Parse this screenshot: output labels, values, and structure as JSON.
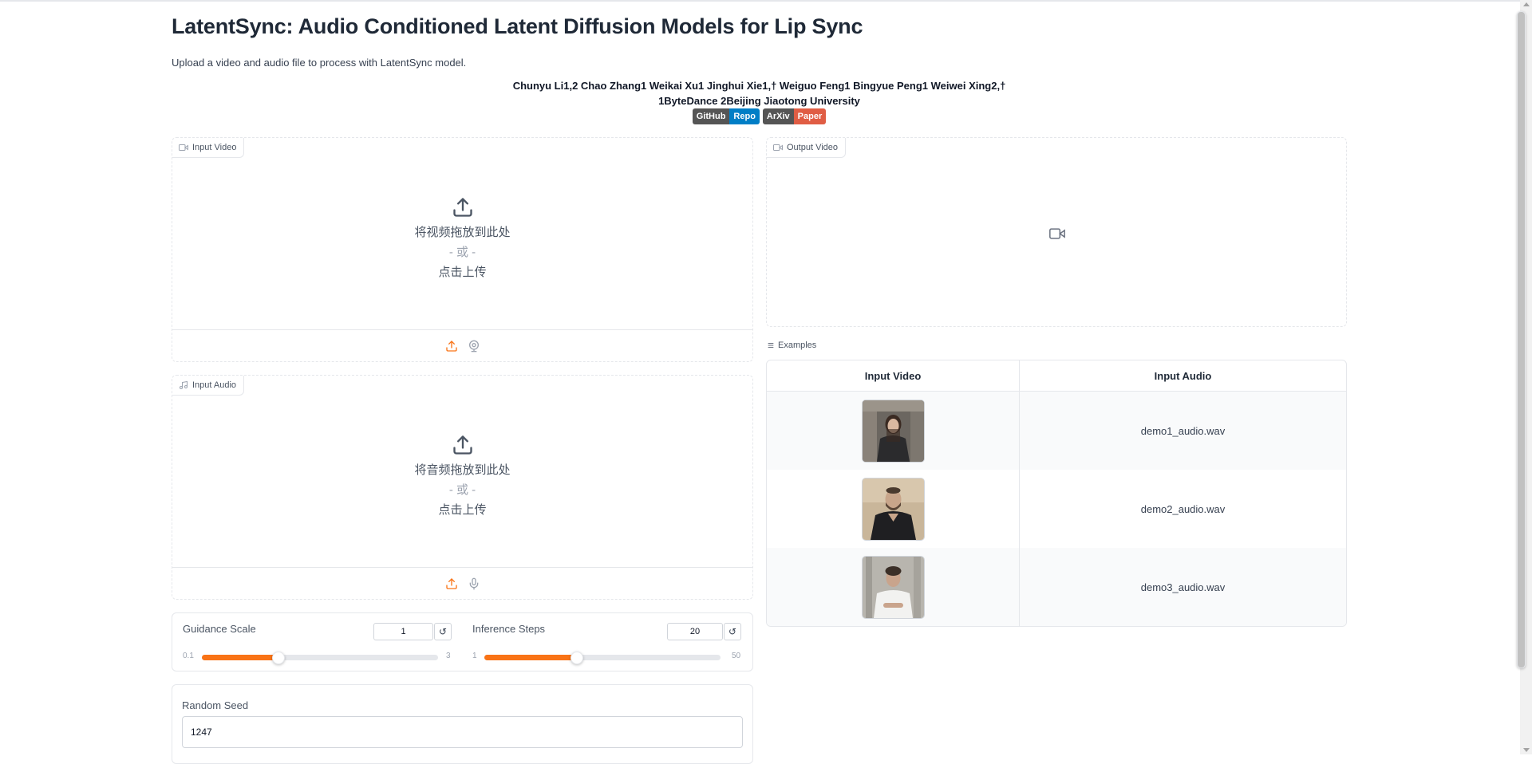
{
  "header": {
    "title": "LatentSync: Audio Conditioned Latent Diffusion Models for Lip Sync",
    "subtitle": "Upload a video and audio file to process with LatentSync model.",
    "authors_line1": "Chunyu Li1,2 Chao Zhang1 Weikai Xu1 Jinghui Xie1,† Weiguo Feng1 Bingyue Peng1 Weiwei Xing2,†",
    "authors_line2": "1ByteDance 2Beijing Jiaotong University",
    "badges": [
      {
        "left": "GitHub",
        "right": "Repo",
        "right_color": "#007ec6"
      },
      {
        "left": "ArXiv",
        "right": "Paper",
        "right_color": "#e05d44"
      }
    ]
  },
  "input_video": {
    "label": "Input Video",
    "drop_text": "将视频拖放到此处",
    "or_text": "- 或 -",
    "click_text": "点击上传"
  },
  "input_audio": {
    "label": "Input Audio",
    "drop_text": "将音频拖放到此处",
    "or_text": "- 或 -",
    "click_text": "点击上传"
  },
  "guidance_scale": {
    "label": "Guidance Scale",
    "value": "1",
    "min": "0.1",
    "max": "3",
    "fill_fraction": 0.32
  },
  "inference_steps": {
    "label": "Inference Steps",
    "value": "20",
    "min": "1",
    "max": "50",
    "fill_fraction": 0.39
  },
  "random_seed": {
    "label": "Random Seed",
    "value": "1247"
  },
  "output_video": {
    "label": "Output Video"
  },
  "examples": {
    "label": "Examples",
    "headers": [
      "Input Video",
      "Input Audio"
    ],
    "rows": [
      {
        "audio": "demo1_audio.wav"
      },
      {
        "audio": "demo2_audio.wav"
      },
      {
        "audio": "demo3_audio.wav"
      }
    ]
  },
  "colors": {
    "accent": "#f97316",
    "border": "#e5e7eb"
  }
}
